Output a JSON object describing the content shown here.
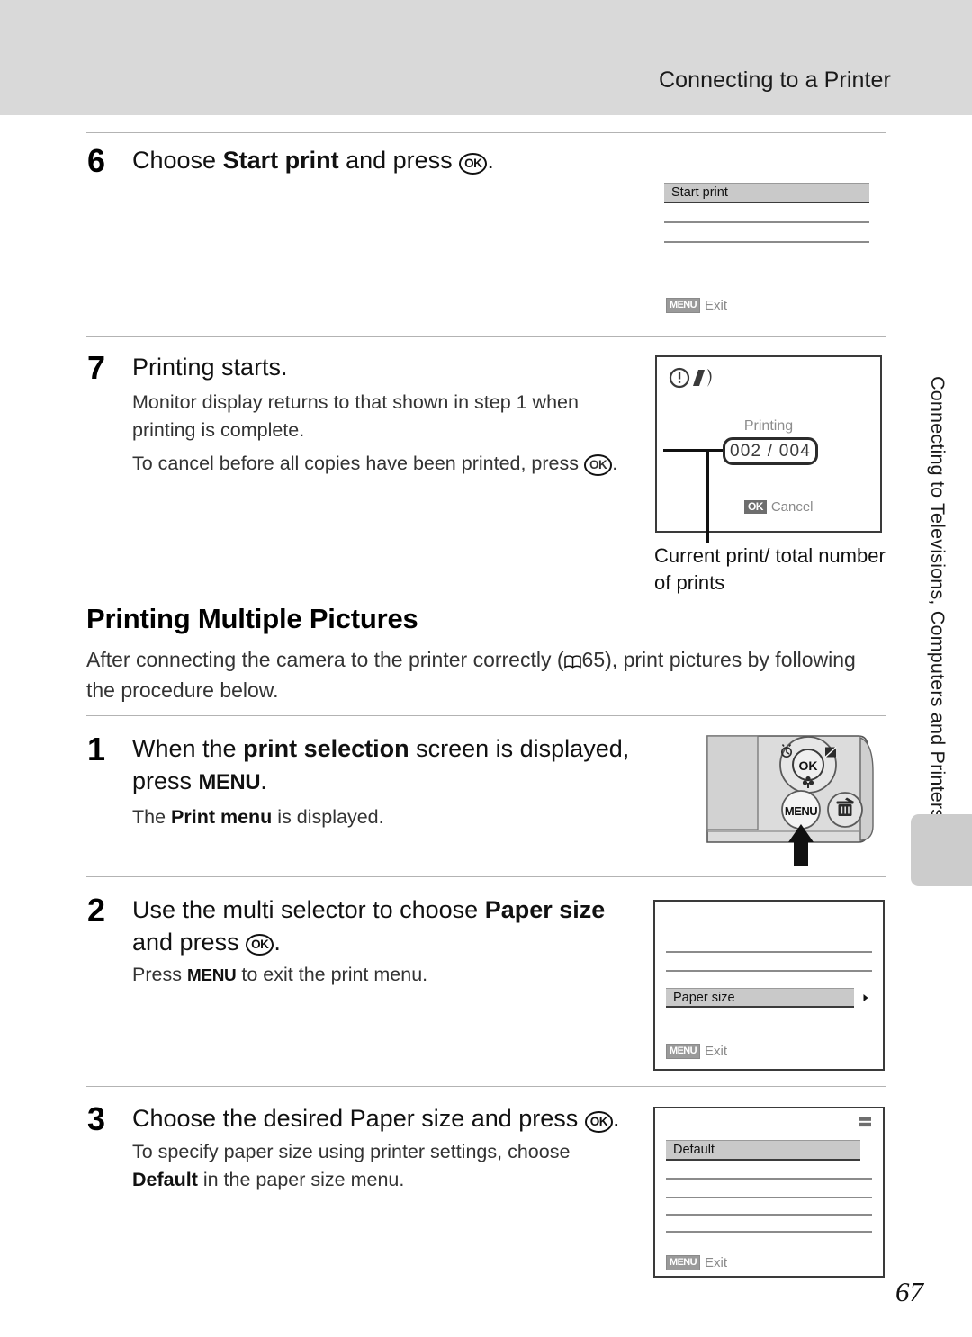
{
  "header": {
    "title": "Connecting to a Printer"
  },
  "steps": [
    {
      "num": "6",
      "title_pre": "Choose ",
      "title_bold": "Start print",
      "title_post": " and press ",
      "title_glyph": "OK",
      "title_end": "."
    },
    {
      "num": "7",
      "title": "Printing starts.",
      "body1": "Monitor display returns to that shown in step 1 when printing is complete.",
      "body2_pre": "To cancel before all copies have been printed, press ",
      "body2_glyph": "OK",
      "body2_end": "."
    },
    {
      "num": "1",
      "title_pre": "When the ",
      "title_bold": "print selection",
      "title_post": " screen is displayed, press ",
      "title_menu": "MENU",
      "title_end": ".",
      "body_pre": "The ",
      "body_bold": "Print menu",
      "body_post": " is displayed."
    },
    {
      "num": "2",
      "title_pre": "Use the multi selector to choose ",
      "title_bold": "Paper size",
      "title_post": " and press ",
      "title_glyph": "OK",
      "title_end": ".",
      "body_pre": "Press ",
      "body_menu": "MENU",
      "body_post": " to exit the print menu."
    },
    {
      "num": "3",
      "title": "Choose the desired Paper size and press ",
      "title_glyph": "OK",
      "title_end": ".",
      "body_pre": "To specify paper size using printer settings, choose ",
      "body_bold": "Default",
      "body_post": " in the paper size menu."
    }
  ],
  "section": {
    "heading": "Printing Multiple Pictures",
    "intro_pre": "After connecting the camera to the printer correctly (",
    "intro_ref": "65",
    "intro_post": "), print pictures by following the procedure below."
  },
  "screens": {
    "start_print": {
      "selected_item": "Start print",
      "foot_badge": "MENU",
      "foot_label": "Exit"
    },
    "printing": {
      "label": "Printing",
      "count": "002 / 004",
      "foot_badge": "OK",
      "foot_label": "Cancel",
      "caption": "Current print/ total number of prints"
    },
    "paper_size_menu": {
      "selected_item": "Paper size",
      "foot_badge": "MENU",
      "foot_label": "Exit"
    },
    "paper_size_options": {
      "selected_item": "Default",
      "foot_badge": "MENU",
      "foot_label": "Exit"
    }
  },
  "camera": {
    "ok_button": "OK",
    "menu_button": "MENU"
  },
  "side_tab": {
    "label": "Connecting to Televisions, Computers and Printers"
  },
  "page_number": "67",
  "colors": {
    "header_band": "#d9d9d9",
    "rule": "#b3b3b3",
    "lcd_border": "#3a3a3a",
    "selection_fill": "#c9c9c9",
    "tab_mark": "#cccccc"
  }
}
